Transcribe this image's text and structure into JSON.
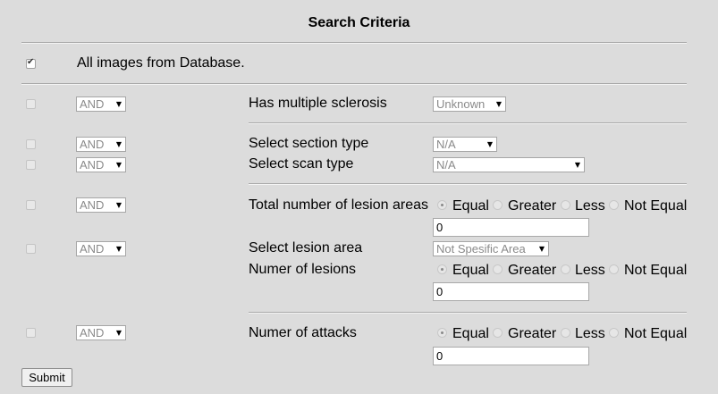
{
  "title": "Search Criteria",
  "all_images": {
    "checked": true,
    "label": "All images from Database."
  },
  "op_options": [
    "AND"
  ],
  "rows": {
    "ms": {
      "op": "AND",
      "label": "Has multiple sclerosis",
      "value": "Unknown"
    },
    "section": {
      "op": "AND",
      "label": "Select section type",
      "value": "N/A"
    },
    "scan": {
      "op": "AND",
      "label": "Select scan type",
      "value": "N/A"
    },
    "total_lesion": {
      "op": "AND",
      "label": "Total number of lesion areas",
      "input": "0"
    },
    "lesion_area": {
      "op": "AND",
      "label": "Select lesion area",
      "value": "Not Spesific Area"
    },
    "num_lesions": {
      "label": "Numer of lesions",
      "input": "0"
    },
    "attacks": {
      "op": "AND",
      "label": "Numer of attacks",
      "input": "0"
    }
  },
  "compare": {
    "equal": "Equal",
    "greater": "Greater",
    "less": "Less",
    "not_equal": "Not Equal"
  },
  "submit_label": "Submit"
}
